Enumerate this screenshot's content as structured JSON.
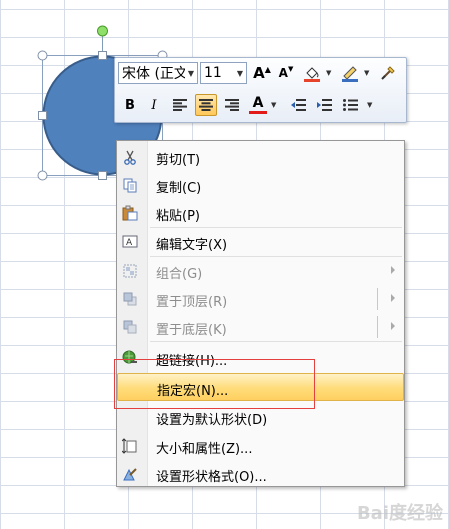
{
  "mini_toolbar": {
    "font_name": "宋体 (正文",
    "font_size": "11",
    "grow_font_glyph": "A",
    "shrink_font_glyph": "A",
    "bold_glyph": "B",
    "italic_glyph": "I",
    "font_color_glyph": "A",
    "colors": {
      "fill": "#e8442c",
      "line": "#3a6fbf",
      "font": "#e21a1a"
    }
  },
  "context_menu": {
    "items": [
      {
        "label": "剪切(T)",
        "icon": "scissors-icon",
        "enabled": true
      },
      {
        "label": "复制(C)",
        "icon": "copy-icon",
        "enabled": true
      },
      {
        "label": "粘贴(P)",
        "icon": "paste-icon",
        "enabled": true
      },
      {
        "label": "编辑文字(X)",
        "icon": "edit-text-icon",
        "enabled": true
      },
      {
        "label": "组合(G)",
        "icon": "group-icon",
        "enabled": false
      },
      {
        "label": "置于顶层(R)",
        "icon": "bring-to-front-icon",
        "enabled": false
      },
      {
        "label": "置于底层(K)",
        "icon": "send-to-back-icon",
        "enabled": false
      },
      {
        "label": "超链接(H)...",
        "icon": "hyperlink-icon",
        "enabled": true
      },
      {
        "label": "指定宏(N)...",
        "icon": "",
        "enabled": true
      },
      {
        "label": "设置为默认形状(D)",
        "icon": "",
        "enabled": true
      },
      {
        "label": "大小和属性(Z)...",
        "icon": "size-icon",
        "enabled": true
      },
      {
        "label": "设置形状格式(O)...",
        "icon": "format-shape-icon",
        "enabled": true
      }
    ]
  },
  "shape": {
    "fill": "#4f81bd",
    "stroke": "#385d8a"
  },
  "watermark": "Bai度经验"
}
